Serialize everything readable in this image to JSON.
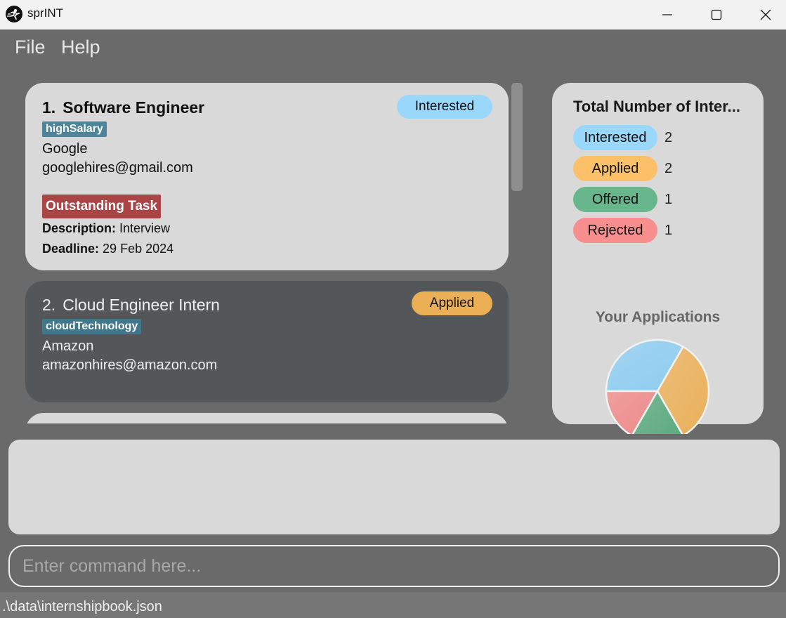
{
  "window": {
    "title": "sprINT",
    "icon": "runner-logo-icon",
    "controls": [
      "minimize-icon",
      "maximize-icon",
      "close-icon"
    ]
  },
  "menu": {
    "items": [
      {
        "label": "File"
      },
      {
        "label": "Help"
      }
    ]
  },
  "applications": [
    {
      "index": "1.",
      "role": "Software Engineer",
      "tag": "highSalary",
      "company": "Google",
      "email": "googlehires@gmail.com",
      "status": "Interested",
      "status_color": "#9ad8fb",
      "selected": false,
      "task": {
        "badge": "Outstanding Task",
        "description_label": "Description:",
        "description": "Interview",
        "deadline_label": "Deadline:",
        "deadline": "29 Feb 2024"
      }
    },
    {
      "index": "2.",
      "role": "Cloud Engineer Intern",
      "tag": "cloudTechnology",
      "company": "Amazon",
      "email": "amazonhires@amazon.com",
      "status": "Applied",
      "status_color": "#ebb055",
      "selected": true
    }
  ],
  "stats": {
    "title": "Total Number of Inter...",
    "rows": [
      {
        "label": "Interested",
        "count": "2",
        "color": "#9ad8fb"
      },
      {
        "label": "Applied",
        "count": "2",
        "color": "#fcc069"
      },
      {
        "label": "Offered",
        "count": "1",
        "color": "#68b68c"
      },
      {
        "label": "Rejected",
        "count": "1",
        "color": "#f88e8e"
      }
    ],
    "chart_title": "Your Applications"
  },
  "chart_data": {
    "type": "pie",
    "title": "Your Applications",
    "categories": [
      "Interested",
      "Applied",
      "Offered",
      "Rejected"
    ],
    "values": [
      2,
      2,
      1,
      1
    ],
    "colors": [
      "#8fcdf0",
      "#eab05a",
      "#5aa97f",
      "#ee8a8a"
    ]
  },
  "result_display": {
    "text": ""
  },
  "command": {
    "value": "",
    "placeholder": "Enter command here..."
  },
  "statusbar": {
    "path": ".\\data\\internshipbook.json"
  }
}
